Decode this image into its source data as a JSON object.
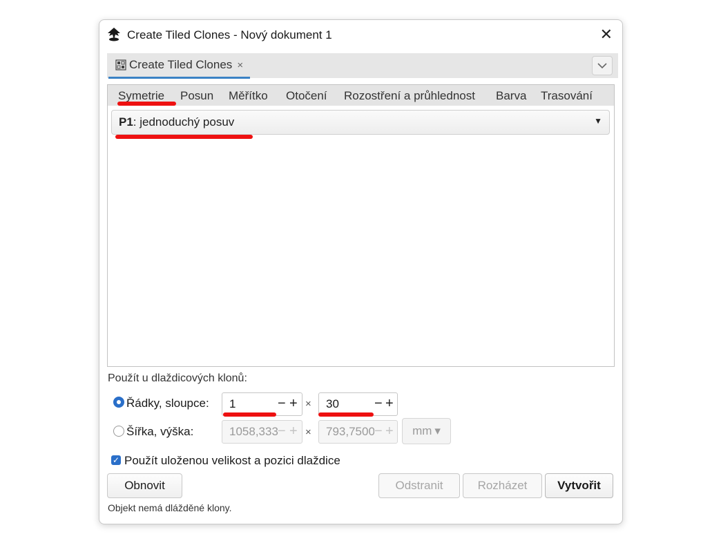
{
  "window": {
    "title": "Create Tiled Clones - Nový dokument 1",
    "close_glyph": "✕",
    "app_icon": "inkscape-icon"
  },
  "doc_tab": {
    "label": "Create Tiled Clones",
    "close_glyph": "×",
    "icon": "tiled-clones-icon",
    "collapse_glyph": "⌵"
  },
  "subtabs": [
    "Symetrie",
    "Posun",
    "Měřítko",
    "Otočení",
    "Rozostření a průhlednost",
    "Barva",
    "Trasování"
  ],
  "symmetry": {
    "code": "P1",
    "text": ": jednoduchý posuv",
    "arrow": "▼"
  },
  "apply_section": {
    "label": "Použít u dlaždicových klonů:",
    "rows_cols": {
      "label": "Řádky, sloupce:",
      "selected": true,
      "rows": "1",
      "cols": "30"
    },
    "width_height": {
      "label": "Šířka, výška:",
      "selected": false,
      "width": "1058,333",
      "height": "793,7500",
      "unit": "mm",
      "unit_arrow": "▾"
    },
    "times": "×",
    "minus": "−",
    "plus": "+"
  },
  "use_saved": {
    "label": "Použít uloženou velikost a pozici dlaždice",
    "checked": true,
    "check_glyph": "✓"
  },
  "buttons": {
    "refresh": "Obnovit",
    "remove": "Odstranit",
    "scatter": "Rozházet",
    "create": "Vytvořit"
  },
  "status": "Objekt nemá dlážděné klony.",
  "colors": {
    "accent": "#2a6fc9",
    "annotation": "#ee1111",
    "tab_underline": "#3b82c4"
  }
}
